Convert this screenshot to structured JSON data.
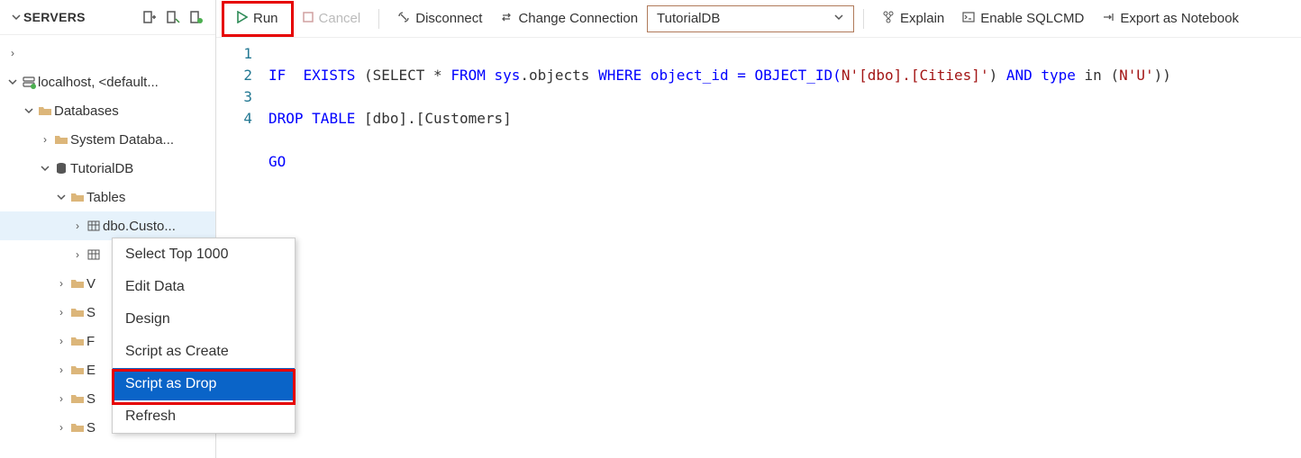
{
  "sidebar": {
    "title": "SERVERS",
    "nodes": {
      "localhost": "localhost, <default...",
      "databases": "Databases",
      "sysdb": "System Databa...",
      "tutorialdb": "TutorialDB",
      "tables": "Tables",
      "dbo_custo": "dbo.Custo...",
      "views_stub": "V",
      "s_stub": "S",
      "f_stub": "F",
      "e_stub": "E",
      "s2_stub": "S",
      "s3_stub": "S"
    }
  },
  "toolbar": {
    "run": "Run",
    "cancel": "Cancel",
    "disconnect": "Disconnect",
    "change_conn": "Change Connection",
    "db_selected": "TutorialDB",
    "explain": "Explain",
    "enable_sqlcmd": "Enable SQLCMD",
    "export_nb": "Export as Notebook"
  },
  "editor": {
    "lines": [
      "1",
      "2",
      "3",
      "4"
    ],
    "tokens": {
      "l1a": "IF",
      "l1b": "  EXISTS ",
      "l1c": "(SELECT",
      "l1d": " * ",
      "l1e": "FROM",
      "l1f": " sys",
      "l1g": ".objects ",
      "l1h": "WHERE",
      "l1i": " object_id = OBJECT_ID(",
      "l1j": "N'[dbo].[Cities]'",
      "l1k": ") ",
      "l1l": "AND",
      "l1m": " type ",
      "l1n": "in",
      "l1o": " (",
      "l1p": "N'U'",
      "l1q": "))",
      "l2a": "DROP",
      "l2b": " ",
      "l2c": "TABLE",
      "l2d": " [dbo].[Customers]",
      "l3a": "GO"
    }
  },
  "context_menu": {
    "select_top": "Select Top 1000",
    "edit_data": "Edit Data",
    "design": "Design",
    "script_create": "Script as Create",
    "script_drop": "Script as Drop",
    "refresh": "Refresh"
  }
}
